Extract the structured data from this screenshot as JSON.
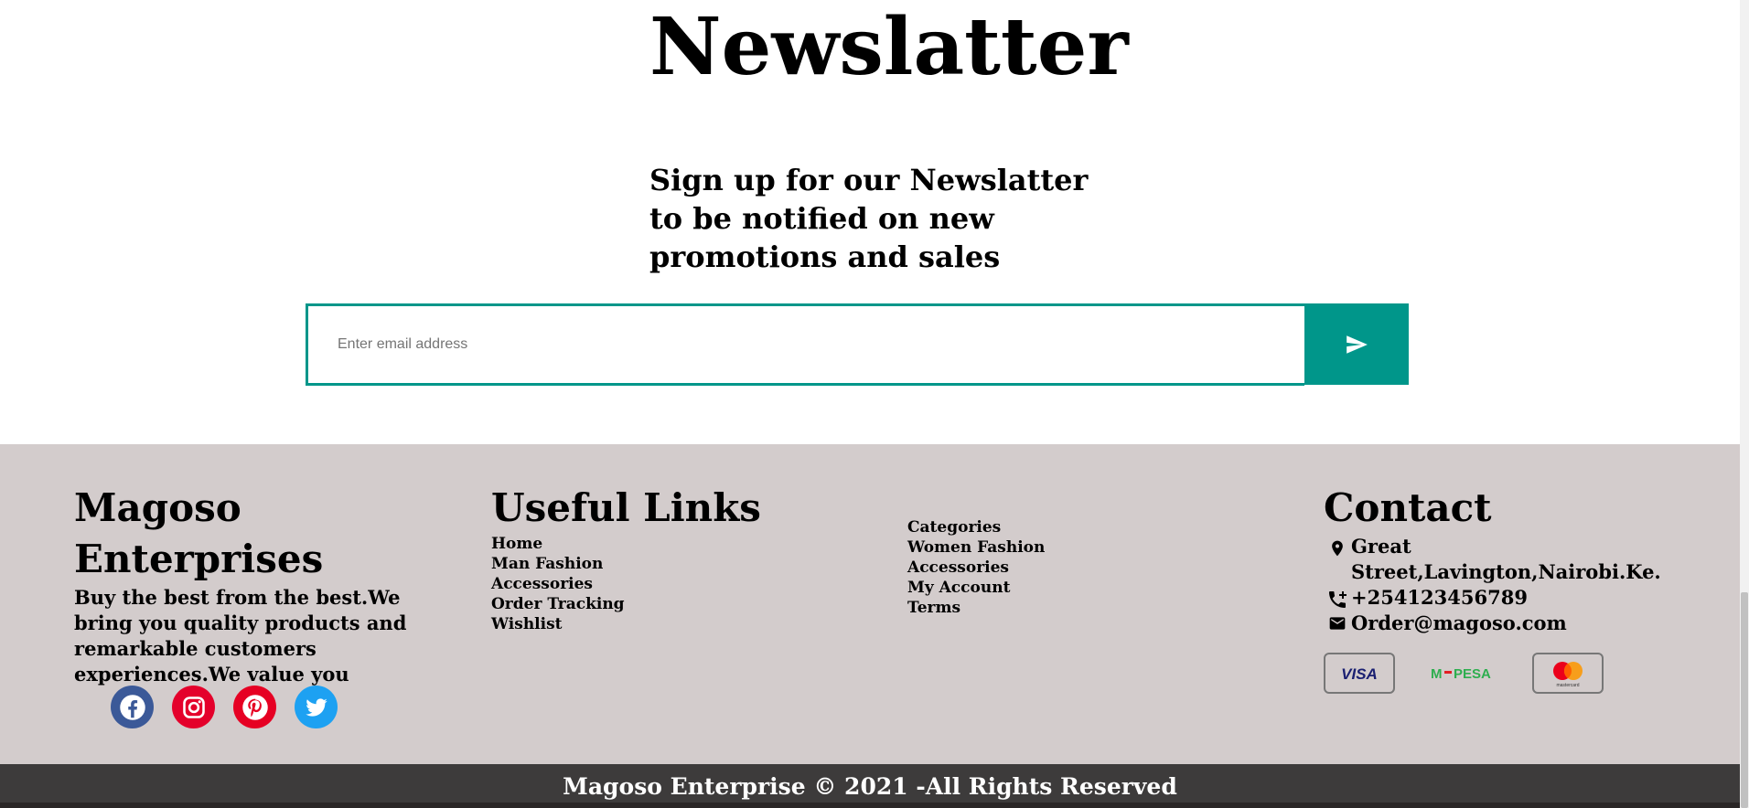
{
  "newsletter": {
    "title": "Newslatter",
    "subtitle": "Sign up for our Newslatter to be notified on new promotions and sales",
    "email_placeholder": "Enter email address",
    "send_icon": "send-icon",
    "accent_color": "#00968a"
  },
  "footer": {
    "brand": {
      "name": "Magoso Enterprises",
      "description": "Buy the best from the best.We bring you quality products and remarkable customers experiences.We value you"
    },
    "social": [
      {
        "name": "facebook-icon",
        "color": "#3b5998"
      },
      {
        "name": "instagram-icon",
        "color": "#e4002b"
      },
      {
        "name": "pinterest-icon",
        "color": "#e60023"
      },
      {
        "name": "twitter-icon",
        "color": "#1da1f2"
      }
    ],
    "useful_links": {
      "title": "Useful Links",
      "items": [
        "Home",
        "Man Fashion",
        "Accessories",
        "Order Tracking",
        "Wishlist"
      ]
    },
    "more_links": {
      "items": [
        "Categories",
        "Women Fashion",
        "Accessories",
        "My Account",
        "Terms"
      ]
    },
    "contact": {
      "title": "Contact",
      "address": "Great Street,Lavington,Nairobi.Ke.",
      "phone": "+254123456789",
      "email": "Order@magoso.com"
    },
    "payments": [
      "VISA",
      "M-PESA",
      "mastercard"
    ],
    "background": "#d3cccc"
  },
  "bottom": {
    "copyright": "Magoso Enterprise © 2021 -All Rights Reserved"
  }
}
